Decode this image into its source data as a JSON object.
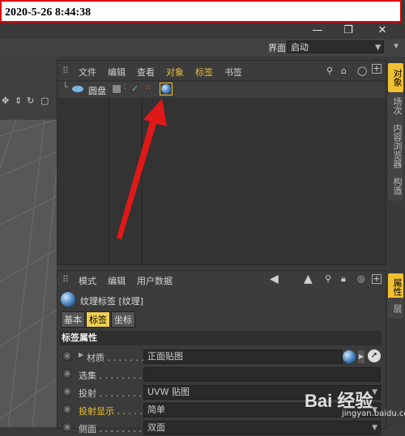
{
  "timestamp": "2020-5-26 8:44:38",
  "layout": {
    "label": "界面:",
    "value": "启动"
  },
  "object_manager": {
    "menu": [
      "文件",
      "编辑",
      "查看",
      "对象",
      "标签",
      "书签"
    ],
    "object": {
      "name": "圆盘"
    }
  },
  "side_tabs_top": [
    "对象",
    "场次",
    "内容浏览器",
    "构造"
  ],
  "side_tabs_bottom": [
    "属性",
    "层"
  ],
  "attributes": {
    "menu": [
      "模式",
      "编辑",
      "用户数据"
    ],
    "title": "纹理标签 [纹理]",
    "tabs": [
      "基本",
      "标签",
      "坐标"
    ],
    "active_tab": "标签",
    "section": "标签属性",
    "props": [
      {
        "label": "材质 . . . . . . .",
        "value": "正面贴图",
        "highlight": false
      },
      {
        "label": "选集 . . . . . . . . .",
        "value": "",
        "highlight": false
      },
      {
        "label": "投射 . . . . . . . . .",
        "value": "UVW 贴图",
        "highlight": false
      },
      {
        "label": "投射显示 . . . . .",
        "value": "简单",
        "highlight": true
      },
      {
        "label": "侧面 . . . . . . . . .",
        "value": "双面",
        "highlight": false
      }
    ]
  },
  "watermark": {
    "brand": "Bai 经验",
    "url": "jingyan.baidu.com"
  },
  "colors": {
    "accent": "#f0c030",
    "arrow": "#e01818",
    "stamp_border": "#e00000"
  }
}
